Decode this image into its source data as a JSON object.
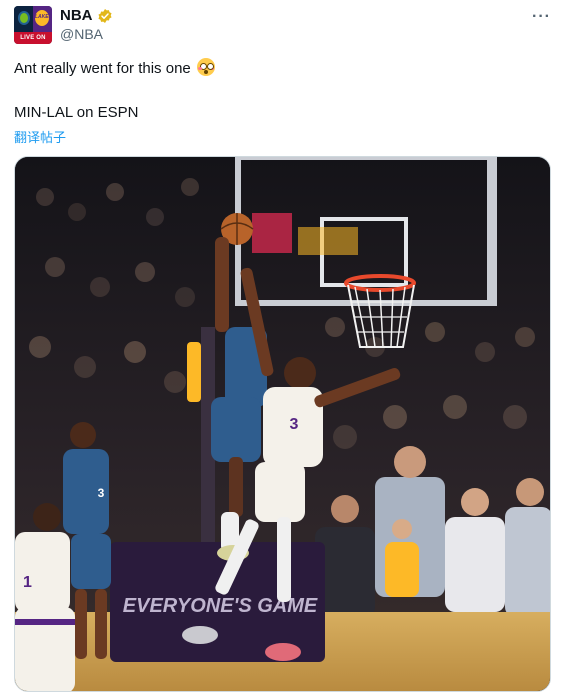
{
  "author": {
    "display_name": "NBA",
    "handle": "@NBA",
    "avatar_label": "LIVE ON ESPN",
    "avatar_right_logo_text": "LAKERS"
  },
  "tweet": {
    "text": "Ant really went for this one",
    "emoji": "flushed-face-emoji",
    "line2": "MIN-LAL on ESPN",
    "translate_label": "翻译帖子"
  },
  "menu": {
    "more_label": "···"
  },
  "media": {
    "type": "video-still",
    "description_icon": "basketball-dunk-image",
    "court_sign_text": "EVERYONE'S GAME",
    "colors": {
      "wolves": "#2f5d8e",
      "lakers_gold": "#fdb927",
      "lakers_white": "#f4f1ea",
      "lakers_purple": "#552583",
      "floor": "#c8a25a"
    }
  },
  "colors": {
    "link": "#1d9bf0",
    "secondary_text": "#536471",
    "verified": "#e2b719"
  }
}
